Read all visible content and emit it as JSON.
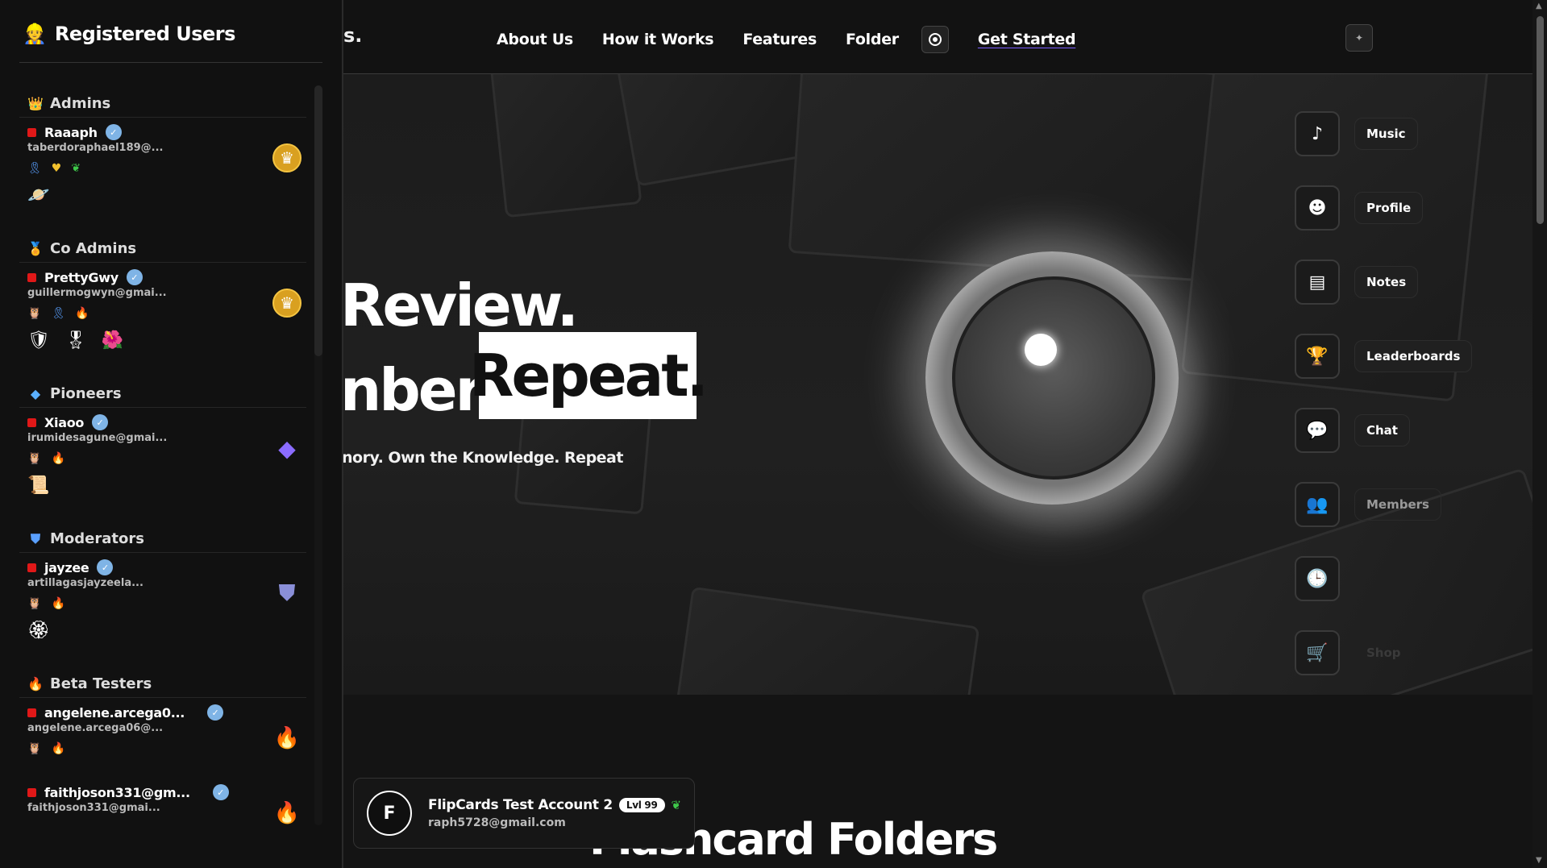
{
  "sidebar": {
    "title": "Registered Users",
    "header_icon": "user-icon",
    "groups": [
      {
        "name": "Admins",
        "icon": "crown-icon",
        "users": [
          {
            "name": "Raaaph",
            "email": "taberdoraphael189@...",
            "role_icon": "crown-icon"
          }
        ]
      },
      {
        "name": "Co Admins",
        "icon": "medal-icon",
        "users": [
          {
            "name": "PrettyGwy",
            "email": "guillermogwyn@gmai...",
            "role_icon": "crown-icon"
          }
        ]
      },
      {
        "name": "Pioneers",
        "icon": "diamond-icon",
        "users": [
          {
            "name": "Xiaoo",
            "email": "irumidesagune@gmai...",
            "role_icon": "diamond-icon"
          }
        ]
      },
      {
        "name": "Moderators",
        "icon": "shield-icon",
        "users": [
          {
            "name": "jayzee",
            "email": "artillagasjayzeela...",
            "role_icon": "shield-icon"
          }
        ]
      },
      {
        "name": "Beta Testers",
        "icon": "flame-icon",
        "users": [
          {
            "name": "angelene.arcega0...",
            "email": "angelene.arcega06@...",
            "role_icon": "flame-icon"
          },
          {
            "name": "faithjoson331@gm...",
            "email": "faithjoson331@gmai...",
            "role_icon": "flame-icon"
          }
        ]
      }
    ]
  },
  "nav": {
    "brand_fragment": "s.",
    "links": [
      "About Us",
      "How it Works",
      "Features",
      "Folder"
    ],
    "cta": "Get Started"
  },
  "hero": {
    "line1": "Review.",
    "line2": "nber.",
    "highlight": "Repeat.",
    "subtitle": "nory. Own the Knowledge. Repeat"
  },
  "side_menu": [
    {
      "label": "Music",
      "icon": "music-note-icon"
    },
    {
      "label": "Profile",
      "icon": "profile-icon"
    },
    {
      "label": "Notes",
      "icon": "notes-icon"
    },
    {
      "label": "Leaderboards",
      "icon": "trophy-icon"
    },
    {
      "label": "Chat",
      "icon": "chat-icon"
    },
    {
      "label": "Members",
      "icon": "members-icon"
    },
    {
      "label": "",
      "icon": "clock-icon"
    },
    {
      "label": "Shop",
      "icon": "cart-icon"
    }
  ],
  "account": {
    "avatar_letter": "F",
    "name": "FlipCards Test Account 2",
    "level": "Lvl 99",
    "email": "raph5728@gmail.com"
  },
  "section_title": "Flashcard Folders",
  "colors": {
    "accent": "#7b5cff",
    "status_offline": "#e01818",
    "verified": "#7fb4e6",
    "crown": "#d9a020"
  }
}
